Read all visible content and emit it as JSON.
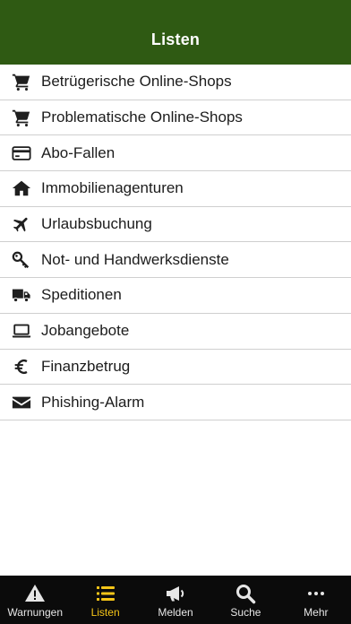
{
  "header": {
    "title": "Listen"
  },
  "list": {
    "items": [
      {
        "label": "Betrügerische Online-Shops",
        "icon": "shopping-cart-icon"
      },
      {
        "label": "Problematische Online-Shops",
        "icon": "shopping-cart-icon"
      },
      {
        "label": "Abo-Fallen",
        "icon": "credit-card-icon"
      },
      {
        "label": "Immobilienagenturen",
        "icon": "house-icon"
      },
      {
        "label": "Urlaubsbuchung",
        "icon": "airplane-icon"
      },
      {
        "label": "Not- und Handwerksdienste",
        "icon": "key-icon"
      },
      {
        "label": "Speditionen",
        "icon": "truck-icon"
      },
      {
        "label": "Jobangebote",
        "icon": "laptop-icon"
      },
      {
        "label": "Finanzbetrug",
        "icon": "euro-icon"
      },
      {
        "label": "Phishing-Alarm",
        "icon": "envelope-icon"
      }
    ]
  },
  "tabbar": {
    "tabs": [
      {
        "label": "Warnungen",
        "icon": "warning-icon",
        "active": false
      },
      {
        "label": "Listen",
        "icon": "list-icon",
        "active": true
      },
      {
        "label": "Melden",
        "icon": "megaphone-icon",
        "active": false
      },
      {
        "label": "Suche",
        "icon": "search-icon",
        "active": false
      },
      {
        "label": "Mehr",
        "icon": "more-icon",
        "active": false
      }
    ]
  },
  "colors": {
    "header_bg": "#2f5a13",
    "tabbar_bg": "#0b0b0b",
    "active_tab": "#f5c518",
    "icon": "#1f1f1f"
  }
}
